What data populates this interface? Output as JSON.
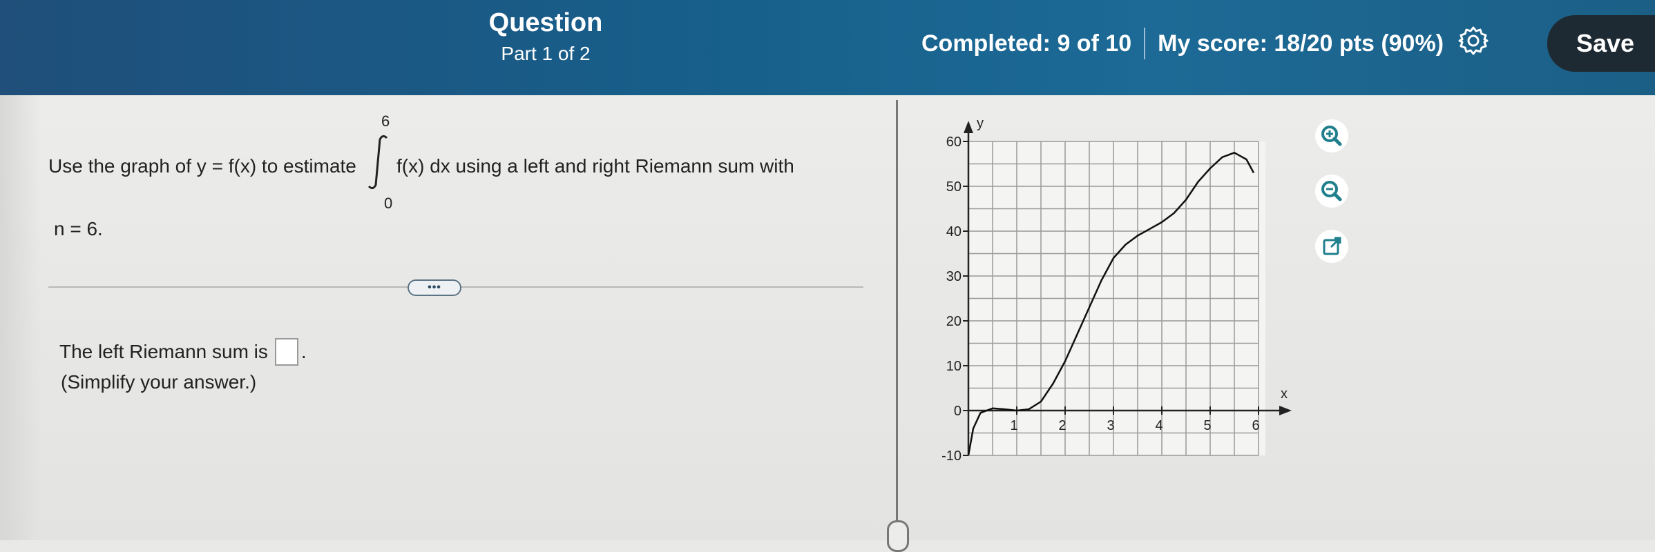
{
  "header": {
    "title": "Question",
    "part": "Part 1 of 2",
    "completed": "Completed: 9 of 10",
    "score": "My score: 18/20 pts (90%)",
    "save_label": "Save",
    "settings_icon": "gear-icon"
  },
  "question": {
    "prompt_before": "Use the graph of y = f(x) to estimate",
    "integral_upper": "6",
    "integral_lower": "0",
    "prompt_after": "f(x) dx using a left and right Riemann sum with",
    "n_line": "n = 6.",
    "more_label": "•••",
    "answer_prefix": "The left Riemann sum is",
    "answer_value": "",
    "answer_suffix": ".",
    "simplify_note": "(Simplify your answer.)"
  },
  "graph_tools": [
    {
      "icon": "zoom-in-icon"
    },
    {
      "icon": "zoom-out-icon"
    },
    {
      "icon": "popout-icon"
    }
  ],
  "colors": {
    "header_bg": "#1b5f86",
    "save_bg": "#1e2a33",
    "tool_accent": "#1f7f8c"
  },
  "chart_data": {
    "type": "line",
    "xlabel": "x",
    "ylabel": "y",
    "xlim": [
      0,
      6.2
    ],
    "ylim": [
      -10,
      60
    ],
    "x_ticks": [
      "1",
      "2",
      "3",
      "4",
      "5",
      "6"
    ],
    "y_ticks": [
      "-10",
      "0",
      "10",
      "20",
      "30",
      "40",
      "50",
      "60"
    ],
    "grid": true,
    "series": [
      {
        "points": [
          [
            0.0,
            -10
          ],
          [
            0.1,
            -4
          ],
          [
            0.25,
            -0.5
          ],
          [
            0.5,
            0.5
          ],
          [
            0.75,
            0.3
          ],
          [
            1.0,
            0
          ],
          [
            1.25,
            0.3
          ],
          [
            1.5,
            2
          ],
          [
            1.75,
            6
          ],
          [
            2.0,
            11
          ],
          [
            2.25,
            17
          ],
          [
            2.5,
            23
          ],
          [
            2.75,
            29
          ],
          [
            3.0,
            34
          ],
          [
            3.25,
            37
          ],
          [
            3.5,
            39
          ],
          [
            3.75,
            40.5
          ],
          [
            4.0,
            42
          ],
          [
            4.25,
            44
          ],
          [
            4.5,
            47
          ],
          [
            4.75,
            51
          ],
          [
            5.0,
            54
          ],
          [
            5.25,
            56.5
          ],
          [
            5.5,
            57.5
          ],
          [
            5.75,
            56
          ],
          [
            5.9,
            53
          ]
        ]
      }
    ]
  }
}
